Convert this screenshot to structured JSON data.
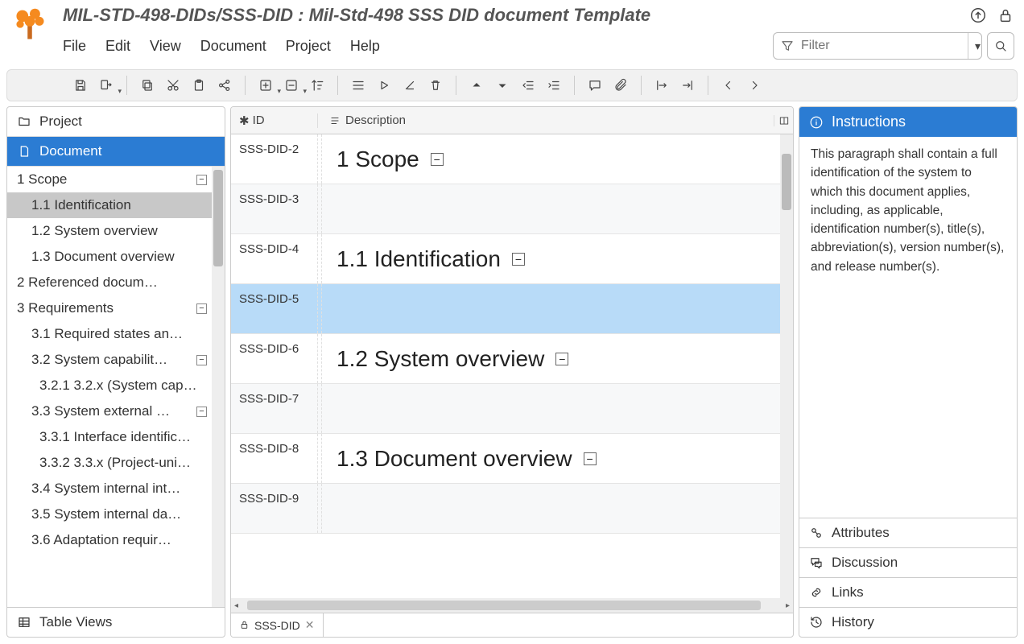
{
  "title": "MIL-STD-498-DIDs/SSS-DID : Mil-Std-498 SSS DID document Template",
  "menu": {
    "file": "File",
    "edit": "Edit",
    "view": "View",
    "document": "Document",
    "project": "Project",
    "help": "Help"
  },
  "filter": {
    "placeholder": "Filter"
  },
  "nav": {
    "project": "Project",
    "document": "Document",
    "table_views": "Table Views"
  },
  "tree": [
    {
      "label": "1 Scope",
      "level": 1,
      "collapsible": true
    },
    {
      "label": "1.1 Identification",
      "level": 2,
      "selected": true
    },
    {
      "label": "1.2 System overview",
      "level": 2
    },
    {
      "label": "1.3 Document overview",
      "level": 2
    },
    {
      "label": "2 Referenced docum…",
      "level": 1
    },
    {
      "label": "3 Requirements",
      "level": 1,
      "collapsible": true
    },
    {
      "label": "3.1 Required states an…",
      "level": 2
    },
    {
      "label": "3.2 System capabilit…",
      "level": 2,
      "collapsible": true
    },
    {
      "label": "3.2.1 3.2.x (System cap…",
      "level": 3
    },
    {
      "label": "3.3 System external …",
      "level": 2,
      "collapsible": true
    },
    {
      "label": "3.3.1 Interface identific…",
      "level": 3
    },
    {
      "label": "3.3.2 3.3.x (Project-uni…",
      "level": 3
    },
    {
      "label": "3.4 System internal int…",
      "level": 2
    },
    {
      "label": "3.5 System internal da…",
      "level": 2
    },
    {
      "label": "3.6 Adaptation requir…",
      "level": 2
    }
  ],
  "grid": {
    "col_id": "ID",
    "col_desc": "Description",
    "rows": [
      {
        "id": "SSS-DID-2",
        "heading": "1 Scope",
        "alt": false
      },
      {
        "id": "SSS-DID-3",
        "heading": "",
        "alt": true
      },
      {
        "id": "SSS-DID-4",
        "heading": "1.1 Identification",
        "alt": false
      },
      {
        "id": "SSS-DID-5",
        "heading": "",
        "alt": true,
        "selected": true
      },
      {
        "id": "SSS-DID-6",
        "heading": "1.2 System overview",
        "alt": false
      },
      {
        "id": "SSS-DID-7",
        "heading": "",
        "alt": true
      },
      {
        "id": "SSS-DID-8",
        "heading": "1.3 Document overview",
        "alt": false
      },
      {
        "id": "SSS-DID-9",
        "heading": "",
        "alt": true
      }
    ]
  },
  "doc_tab": {
    "label": "SSS-DID"
  },
  "instructions": {
    "title": "Instructions",
    "body": "This paragraph shall contain a full identification of the system to which this document applies, including, as applicable, identification number(s), title(s), abbrevia­tion(s), version number(s), and release number(s)."
  },
  "side": {
    "attributes": "Attributes",
    "discussion": "Discussion",
    "links": "Links",
    "history": "History"
  }
}
